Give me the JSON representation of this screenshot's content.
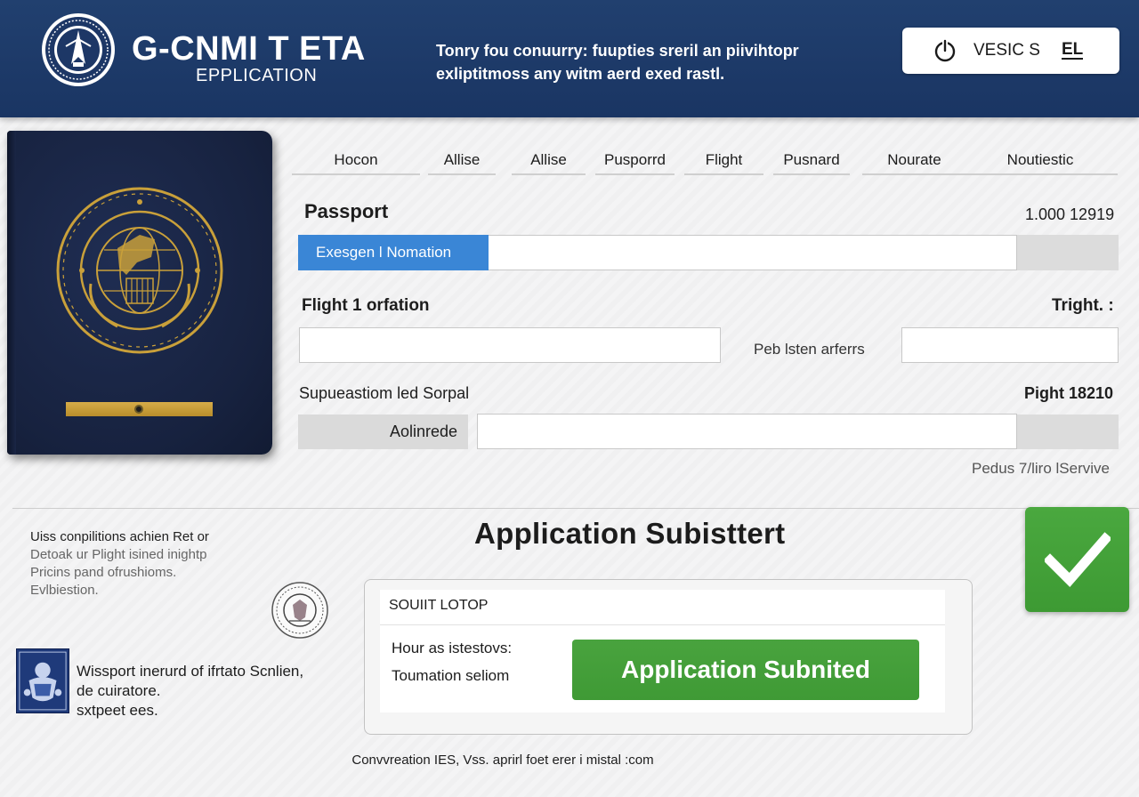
{
  "header": {
    "title": "G-CNMI T ETA",
    "subtitle": "EPPLICATION",
    "notice_line1": "Tonry fou conuurry: fuupties sreril an piivihtopr",
    "notice_line2": "exliptitmoss any witm aerd exed rastl.",
    "version_label": "VESIC S",
    "version_code": "EL"
  },
  "tabs": [
    {
      "label": "Hocon"
    },
    {
      "label": "Allise"
    },
    {
      "label": "Allise"
    },
    {
      "label": "Pusporrd"
    },
    {
      "label": "Flight"
    },
    {
      "label": "Pusnard"
    },
    {
      "label": "Nourate"
    },
    {
      "label": "Noutiestic"
    }
  ],
  "form": {
    "passport": {
      "title": "Passport",
      "number": "1.000 12919",
      "field_prefix": "Exesgen l Nomation"
    },
    "flight": {
      "title": "Flight 1 orfation",
      "right_label": "Tright. :",
      "middle_label": "Peb lsten arferrs"
    },
    "supplement": {
      "title": "Supueastiom led Sorpal",
      "right_label": "Pight  18210",
      "field_label": "Aolinrede"
    },
    "footer_link": "Pedus 7/liro lServive"
  },
  "notes": {
    "line1": "Uiss conpilitions achien Ret or",
    "line2": "Detoak ur Plight isined inightp",
    "line3": "Pricins pand ofrushioms.",
    "line4": "Evlbiestion."
  },
  "bottom_notes": {
    "line1": "Wissport inerurd of ifrtato Scnlien,",
    "line2": "de cuiratore.",
    "line3": "sxtpeet ees."
  },
  "status": {
    "title": "Application Subisttert",
    "card_header": "SOUIIT LOTOP",
    "row1_label": "Hour as istestovs:",
    "row2_label": "Toumation seliom",
    "button_label": "Application Subnited"
  },
  "footer": {
    "text": "Convvreation IES, Vss. aprirl foet erer i mistal :com"
  },
  "colors": {
    "header_bg": "#1e3c6b",
    "accent_blue": "#3a86d6",
    "success_green": "#45a03a",
    "passport_navy": "#17223f",
    "gold": "#c9a03a"
  }
}
